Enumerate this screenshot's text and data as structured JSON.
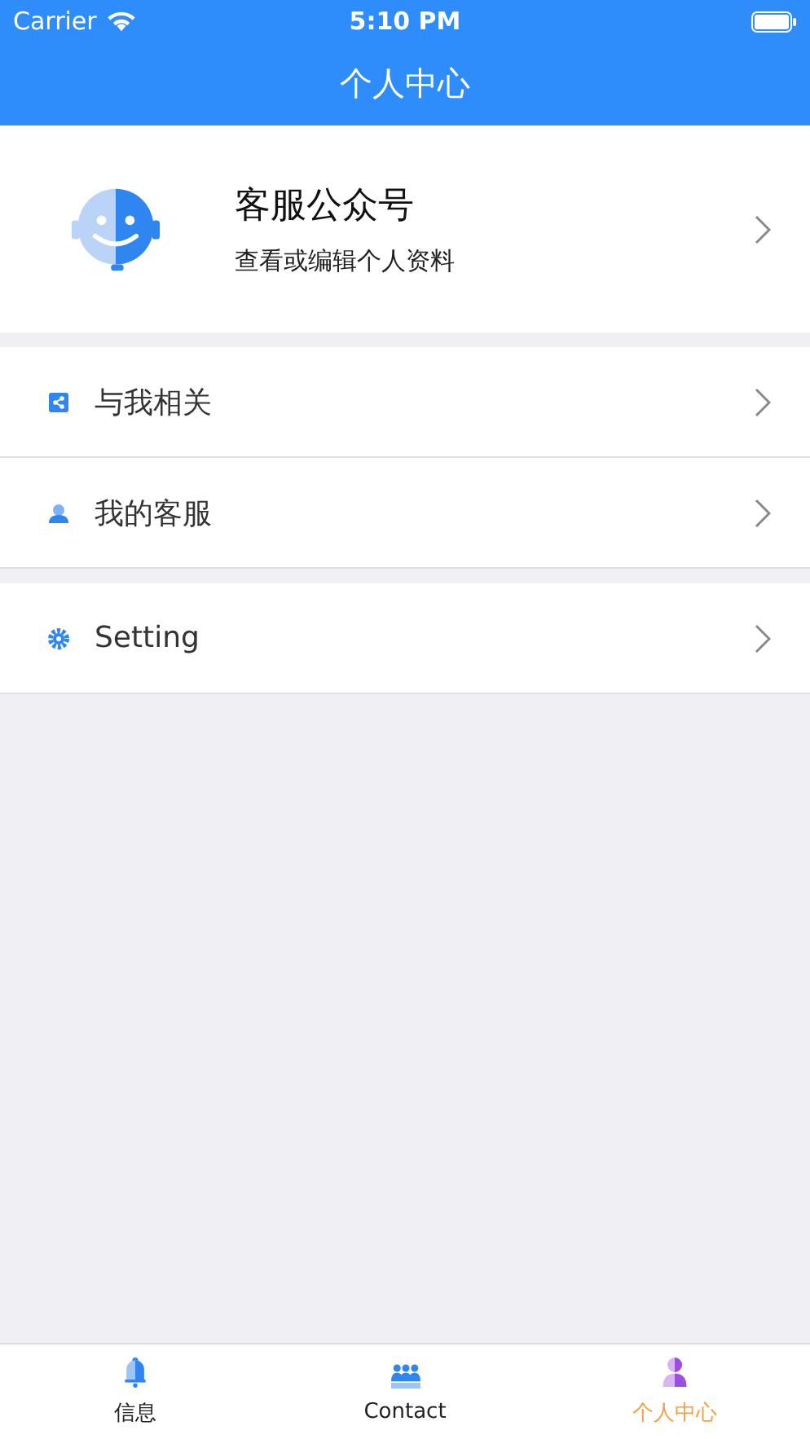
{
  "status_bar": {
    "carrier": "Carrier",
    "time": "5:10 PM"
  },
  "nav_bar": {
    "title": "个人中心"
  },
  "profile": {
    "name": "客服公众号",
    "subtitle": "查看或编辑个人资料"
  },
  "menu_groups": [
    [
      {
        "kind": "share",
        "label": "与我相关"
      },
      {
        "kind": "agent",
        "label": "我的客服"
      }
    ],
    [
      {
        "kind": "gear",
        "label": "Setting"
      }
    ]
  ],
  "tab_bar": [
    {
      "kind": "bell",
      "label": "信息",
      "selected": false
    },
    {
      "kind": "group",
      "label": "Contact",
      "selected": false
    },
    {
      "kind": "person",
      "label": "个人中心",
      "selected": true
    }
  ]
}
